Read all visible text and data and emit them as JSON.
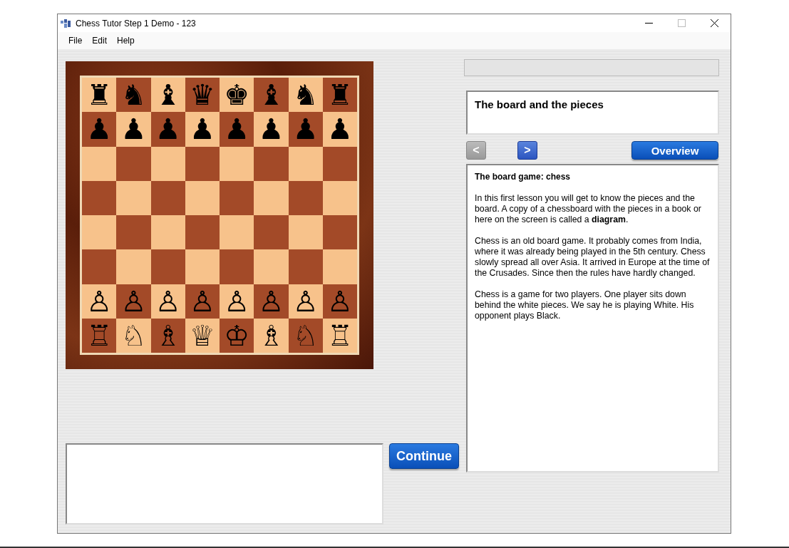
{
  "window": {
    "title": "Chess Tutor Step 1 Demo - 123"
  },
  "menu": [
    "File",
    "Edit",
    "Help"
  ],
  "board": {
    "black_ranks": [
      [
        "♜",
        "♞",
        "♝",
        "♛",
        "♚",
        "♝",
        "♞",
        "♜"
      ],
      [
        "♟",
        "♟",
        "♟",
        "♟",
        "♟",
        "♟",
        "♟",
        "♟"
      ]
    ],
    "white_ranks": [
      [
        "♙",
        "♙",
        "♙",
        "♙",
        "♙",
        "♙",
        "♙",
        "♙"
      ],
      [
        "♖",
        "♘",
        "♗",
        "♕",
        "♔",
        "♗",
        "♘",
        "♖"
      ]
    ]
  },
  "progress": {
    "level": 0
  },
  "continue_button": "Continue",
  "lesson": {
    "title": "The board and the pieces",
    "nav": [
      {
        "label": "<",
        "disabled": true
      },
      {
        "label": ">",
        "disabled": false
      }
    ],
    "overview_button": "Overview",
    "heading": "The board game: chess",
    "paragraphs": [
      "In this first lesson you will get to know the pieces and the board. A copy of a chessboard with the pieces in a book or here on the screen is called a **diagram**.",
      "Chess is an old board game. It probably comes from India, where it was already being played in the 5th century. Chess slowly spread all over Asia. It arrived in Europe at the time of the Crusades. Since then the rules have hardly changed.",
      "Chess is a game for two players. One player sits down behind the white pieces. We say he is playing White. His opponent plays Black."
    ]
  }
}
